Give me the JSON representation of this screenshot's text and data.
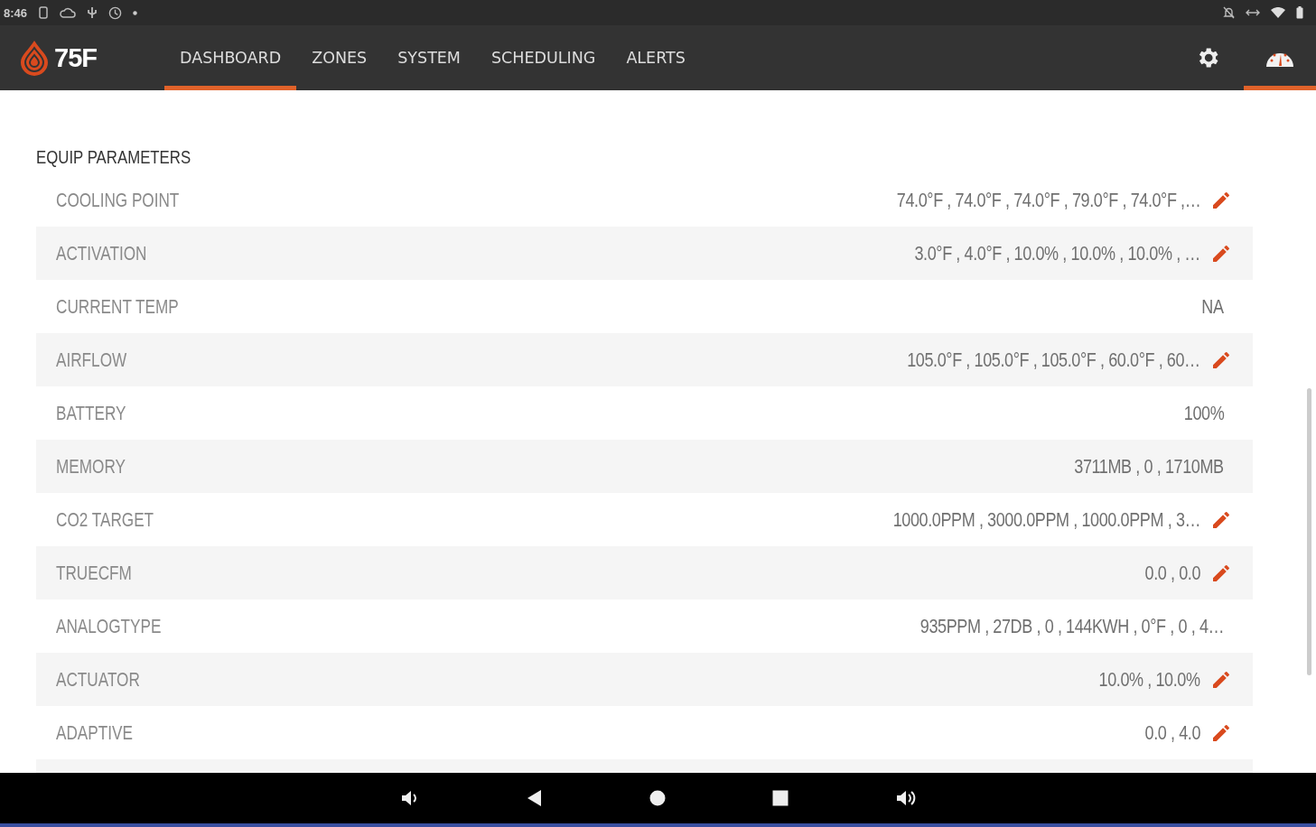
{
  "status_bar": {
    "time": "8:46"
  },
  "nav": {
    "logo": "75F",
    "tabs": [
      {
        "label": "DASHBOARD",
        "selected": true
      },
      {
        "label": "ZONES",
        "selected": false
      },
      {
        "label": "SYSTEM",
        "selected": false
      },
      {
        "label": "SCHEDULING",
        "selected": false
      },
      {
        "label": "ALERTS",
        "selected": false
      }
    ],
    "icon_tabs": [
      {
        "kind": "settings",
        "selected": false
      },
      {
        "kind": "gauge",
        "selected": true
      }
    ]
  },
  "section": {
    "title": "EQUIP PARAMETERS",
    "rows": [
      {
        "label": "COOLING POINT",
        "value": "74.0°F , 74.0°F , 74.0°F , 79.0°F , 74.0°F ,…",
        "editable": true
      },
      {
        "label": "ACTIVATION",
        "value": "3.0°F , 4.0°F , 10.0% , 10.0% , 10.0% , …",
        "editable": true
      },
      {
        "label": "CURRENT TEMP",
        "value": "NA",
        "editable": false
      },
      {
        "label": "AIRFLOW",
        "value": "105.0°F , 105.0°F , 105.0°F , 60.0°F , 60…",
        "editable": true
      },
      {
        "label": "BATTERY",
        "value": "100%",
        "editable": false
      },
      {
        "label": "MEMORY",
        "value": "3711MB , 0 , 1710MB",
        "editable": false
      },
      {
        "label": "CO2 TARGET",
        "value": "1000.0PPM , 3000.0PPM , 1000.0PPM , 3…",
        "editable": true
      },
      {
        "label": "TRUECFM",
        "value": "0.0 , 0.0",
        "editable": true
      },
      {
        "label": "ANALOGTYPE",
        "value": "935PPM , 27DB , 0 , 144KWH , 0°F , 0 , 4…",
        "editable": false
      },
      {
        "label": "ACTUATOR",
        "value": "10.0% , 10.0%",
        "editable": true
      },
      {
        "label": "ADAPTIVE",
        "value": "0.0 , 4.0",
        "editable": true
      }
    ]
  }
}
